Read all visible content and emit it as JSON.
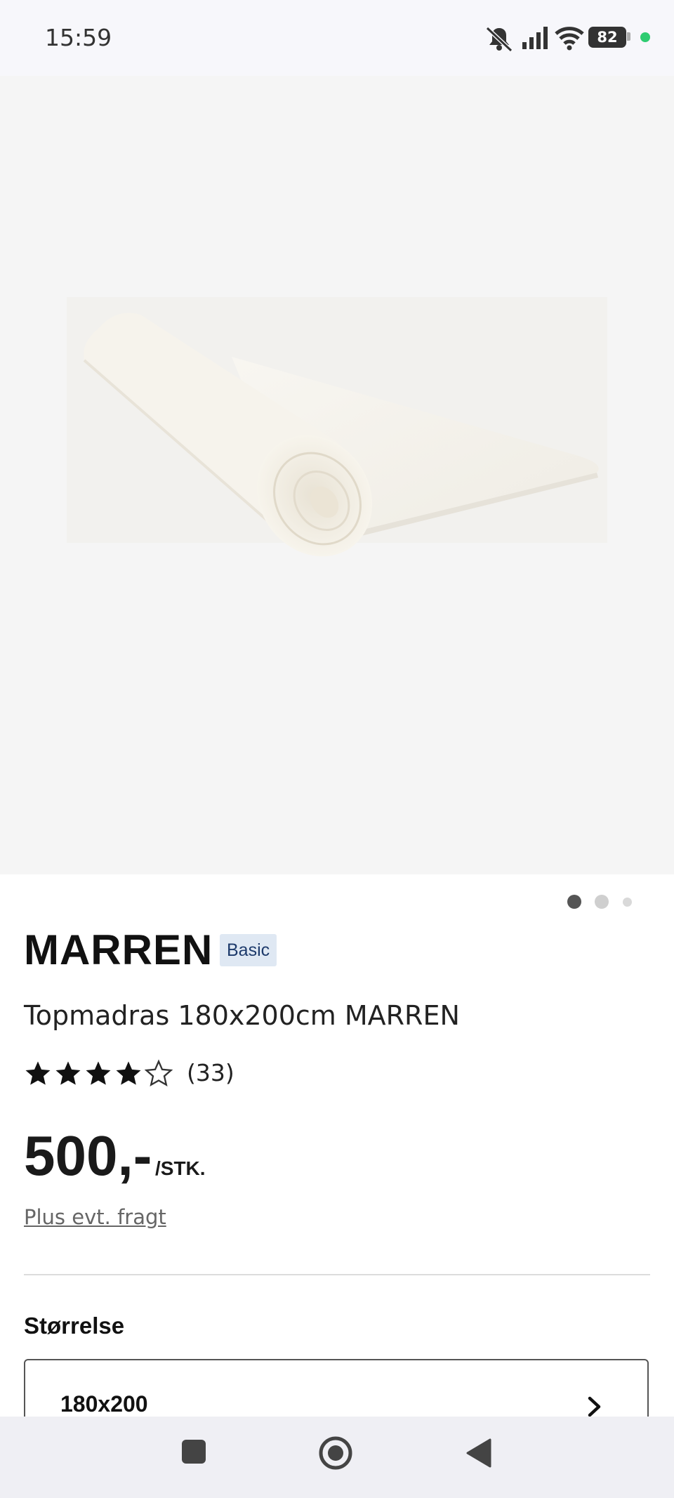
{
  "status_bar": {
    "time": "15:59",
    "battery": "82",
    "icons": [
      "bell-off-icon",
      "signal-icon",
      "wifi-icon",
      "battery-icon",
      "green-dot"
    ]
  },
  "gallery": {
    "image": "rolled-mattress-topper",
    "page_count": 3,
    "active_index": 0
  },
  "product": {
    "brand": "MARREN",
    "badge": "Basic",
    "title": "Topmadras 180x200cm MARREN",
    "rating": 4,
    "rating_max": 5,
    "review_count": "(33)",
    "price": "500,-",
    "unit": "/STK.",
    "shipping_link": "Plus evt. fragt"
  },
  "size_section": {
    "label": "Størrelse",
    "selected": "180x200"
  },
  "nav_bar": {
    "buttons": [
      "recent-apps-button",
      "home-button",
      "back-button"
    ]
  },
  "colors": {
    "accent_green": "#2ecc71",
    "badge_bg": "#dfe8f3",
    "badge_text": "#1d3a6b",
    "hero_bg": "#f5f5f5"
  }
}
